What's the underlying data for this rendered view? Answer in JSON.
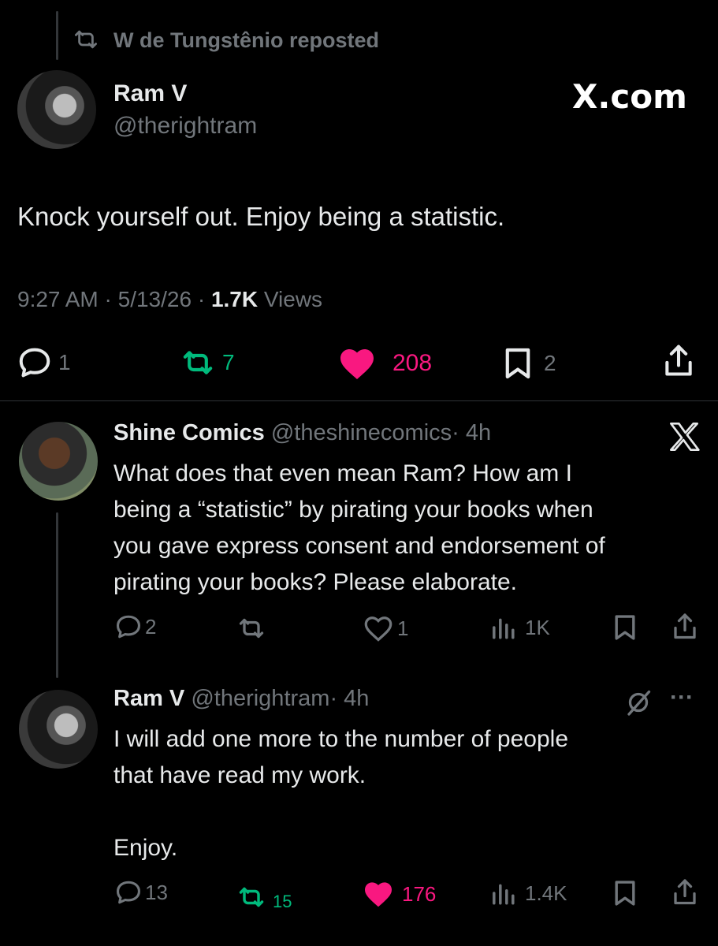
{
  "repost_banner": {
    "text": "W de Tungstênio reposted"
  },
  "main_tweet": {
    "author_name": "Ram V",
    "author_handle": "@therightram",
    "brand": "X.com",
    "text": "Knock yourself out. Enjoy being a statistic.",
    "time": "9:27 AM",
    "sep1": "·",
    "date": "5/13/26",
    "sep2": "·",
    "views_count": "1.7K",
    "views_label": "Views",
    "replies": "1",
    "reposts": "7",
    "likes": "208",
    "bookmarks": "2",
    "colors": {
      "repost": "#00ba7c",
      "like": "#f91880"
    }
  },
  "reply1": {
    "author_name": "Shine Comics",
    "author_handle": "@theshinecomics",
    "time": "· 4h",
    "text_lines": [
      "What does that even mean Ram? How am I",
      "being a “statistic” by pirating your books when",
      "you gave express consent and endorsement of",
      "pirating your books? Please elaborate."
    ],
    "replies": "2",
    "reposts": "",
    "likes": "1",
    "views": "1K"
  },
  "reply2": {
    "author_name": "Ram V",
    "author_handle": "@therightram",
    "time": "· 4h",
    "text_lines": [
      "I will add one more to the number of people",
      "that have read my work.",
      "",
      "Enjoy."
    ],
    "more": "···",
    "replies": "13",
    "reposts": "15",
    "likes": "176",
    "views": "1.4K"
  },
  "icons": [
    "repost-icon",
    "reply-icon",
    "like-icon",
    "bookmark-icon",
    "share-icon",
    "views-icon",
    "x-logo-icon",
    "grok-icon",
    "more-icon"
  ]
}
